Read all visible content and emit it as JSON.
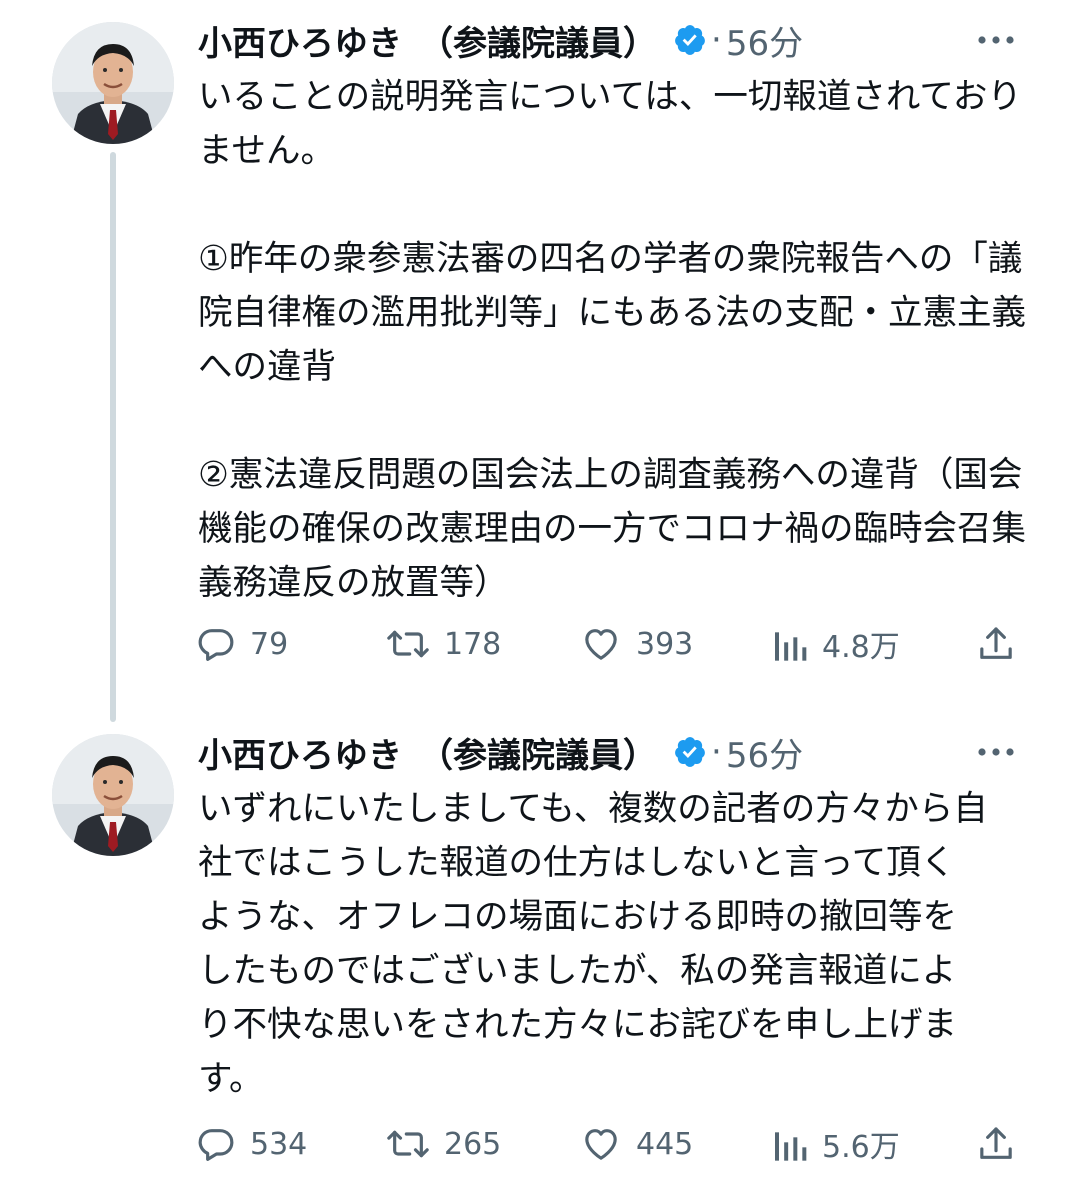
{
  "tweets": [
    {
      "author": "小西ひろゆき　（参議院議員）",
      "time_label": "56分",
      "text": "いることの説明発言については、一切報道されておりません。\n\n①昨年の衆参憲法審の四名の学者の衆院報告への「議院自律権の濫用批判等」にもある法の支配・立憲主義への違背\n\n②憲法違反問題の国会法上の調査義務への違背（国会機能の確保の改憲理由の一方でコロナ禍の臨時会召集義務違反の放置等）",
      "stats": {
        "replies": "79",
        "retweets": "178",
        "likes": "393",
        "views": "4.8万"
      }
    },
    {
      "author": "小西ひろゆき　（参議院議員）",
      "time_label": "56分",
      "text": "いずれにいたしましても、複数の記者の方々から自社ではこうした報道の仕方はしないと言って頂くような、オフレコの場面における即時の撤回等をしたものではございましたが、私の発言報道により不快な思いをされた方々にお詫びを申し上げます。",
      "stats": {
        "replies": "534",
        "retweets": "265",
        "likes": "445",
        "views": "5.6万"
      }
    }
  ],
  "icons": {
    "verified": "verified-badge-icon",
    "more": "more-dots-icon",
    "reply": "reply-bubble-icon",
    "retweet": "retweet-icon",
    "like": "heart-icon",
    "views": "views-bars-icon",
    "share": "share-upload-icon"
  },
  "colors": {
    "text": "#0f1419",
    "secondary": "#536471",
    "verified": "#1d9bf0",
    "thread_line": "#cfd9de"
  }
}
